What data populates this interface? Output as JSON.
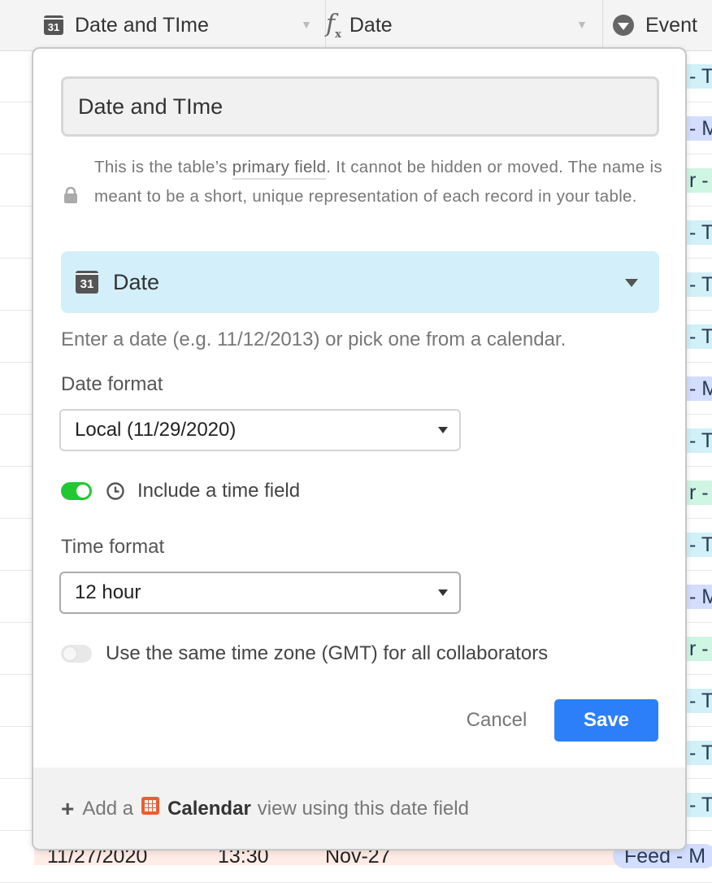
{
  "header": {
    "col1_label": "Date and TIme",
    "col2_label": "Date",
    "col3_label": "Event"
  },
  "grid": {
    "right_pills": [
      {
        "text": "- Tu",
        "color": "cyan"
      },
      {
        "text": "- M",
        "color": "blue"
      },
      {
        "text": "r -",
        "color": "green"
      },
      {
        "text": "- Tu",
        "color": "cyan"
      },
      {
        "text": "- Tu",
        "color": "cyan"
      },
      {
        "text": "- Tu",
        "color": "cyan"
      },
      {
        "text": "- M",
        "color": "blue"
      },
      {
        "text": "- Tu",
        "color": "cyan"
      },
      {
        "text": "r -",
        "color": "green"
      },
      {
        "text": "- Tu",
        "color": "cyan"
      },
      {
        "text": "- M",
        "color": "blue"
      },
      {
        "text": "r -",
        "color": "green"
      },
      {
        "text": "- Tu",
        "color": "cyan"
      },
      {
        "text": "- Tu",
        "color": "cyan"
      },
      {
        "text": "- Tu",
        "color": "cyan"
      }
    ],
    "bottom_row": {
      "date": "11/27/2020",
      "time": "13:30",
      "short_date": "Nov-27",
      "event": "Feed - M"
    }
  },
  "popover": {
    "field_name": "Date and TIme",
    "help_prefix": "This is the table’s ",
    "help_link": "primary field",
    "help_suffix": ". It cannot be hidden or moved. The name is meant to be a short, unique representation of each record in your table.",
    "field_type": "Date",
    "field_type_description": "Enter a date (e.g. 11/12/2013) or pick one from a calendar.",
    "date_format_label": "Date format",
    "date_format_value": "Local (11/29/2020)",
    "include_time_label": "Include a time field",
    "include_time_on": true,
    "time_format_label": "Time format",
    "time_format_value": "12 hour",
    "gmt_label": "Use the same time zone (GMT) for all collaborators",
    "gmt_on": false,
    "cancel_label": "Cancel",
    "save_label": "Save",
    "footer_add": "Add a",
    "footer_calendar": "Calendar",
    "footer_rest": "view using this date field"
  },
  "icons": {
    "calendar_day": "31"
  },
  "colors": {
    "accent": "#2d7ff9",
    "toggle_on": "#20c933",
    "type_picker_bg": "#d2effa",
    "calendar_view_icon": "#f05b2d"
  }
}
